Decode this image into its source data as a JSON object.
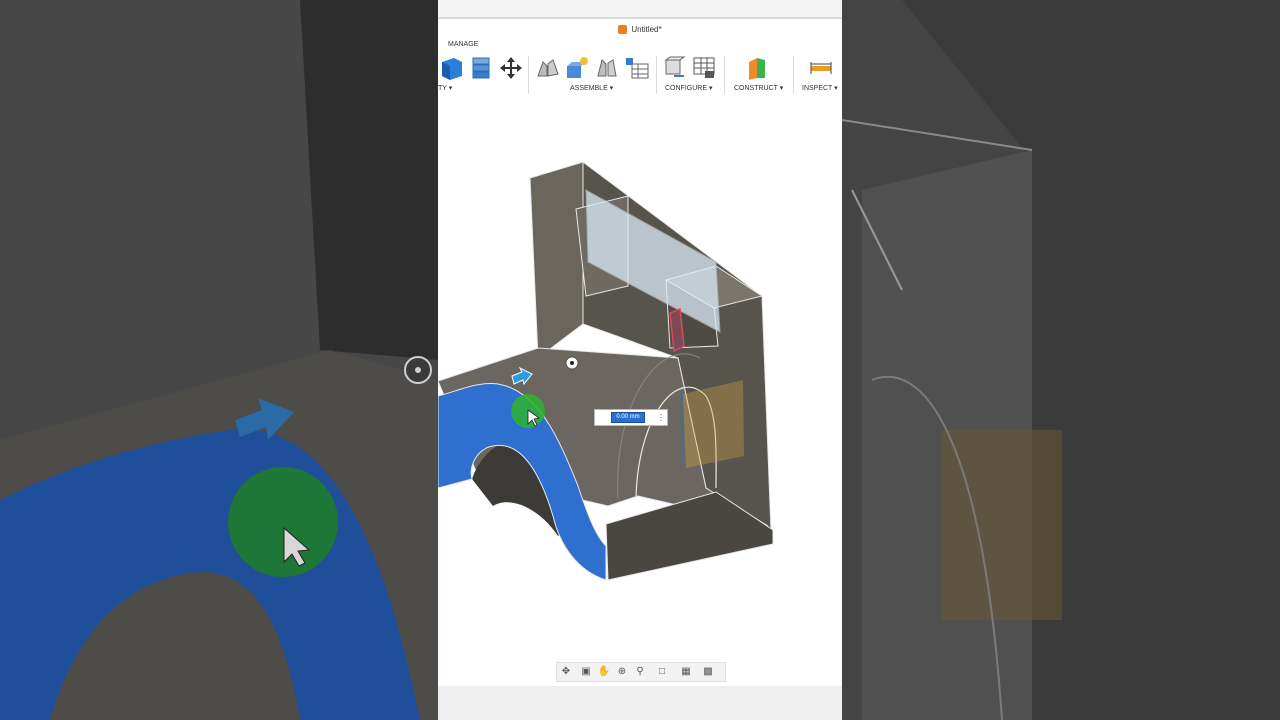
{
  "window": {
    "title": "Untitled*"
  },
  "toolbar": {
    "tab_label": "MANAGE",
    "groups": [
      {
        "label": "TY ▾"
      },
      {
        "label": "ASSEMBLE ▾"
      },
      {
        "label": "CONFIGURE ▾"
      },
      {
        "label": "CONSTRUCT ▾"
      },
      {
        "label": "INSPECT ▾"
      }
    ]
  },
  "dimension": {
    "value": "0.00 mm"
  },
  "colors": {
    "selected_face": "#2f6fd0",
    "body": "#5a5750",
    "plane": "#dcebf6",
    "cursor_highlight": "#2db52d",
    "accent_icon": "#e8801e"
  },
  "icons": {
    "tools": [
      "new-component-icon",
      "component-stack-icon",
      "move-icon",
      "joint-icon",
      "as-built-joint-icon",
      "joint-origin-icon",
      "parameters-table-icon",
      "configure-icon",
      "configure-table-icon",
      "offset-plane-icon",
      "measure-icon"
    ],
    "nav": [
      "orbit-icon",
      "look-at-icon",
      "pan-icon",
      "zoom-icon",
      "fit-icon",
      "display-settings-icon",
      "grid-icon",
      "viewports-icon"
    ]
  }
}
